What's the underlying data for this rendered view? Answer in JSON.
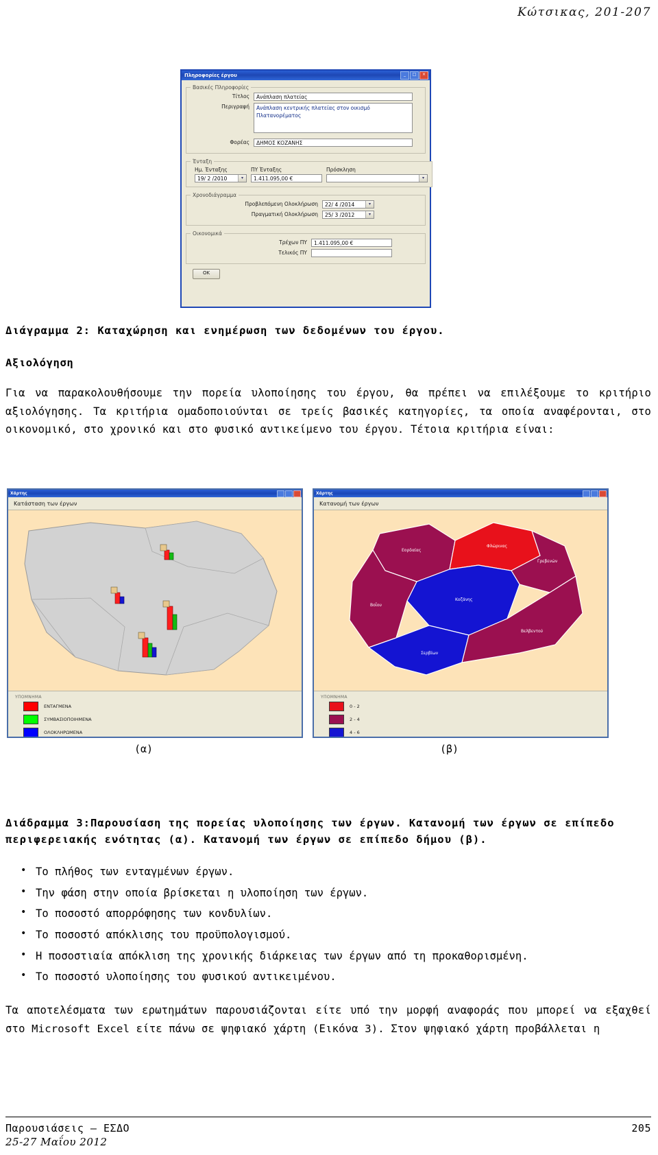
{
  "running_head": "Κώτσικας, 201-207",
  "dialog": {
    "title": "Πληροφορίες έργου",
    "window_buttons": [
      "minimize",
      "maximize",
      "close"
    ],
    "groups": {
      "basic": {
        "legend": "Βασικές Πληροφορίες",
        "fields": [
          {
            "label": "Τίτλος",
            "value": "Ανάπλαση πλατείας",
            "type": "text"
          },
          {
            "label": "Περιγραφή",
            "value": "Ανάπλαση κεντρικής πλατείας στον οικισμό Πλατανορέματος",
            "type": "textarea"
          },
          {
            "label": "Φορέας",
            "value": "ΔΗΜΟΣ ΚΟΖΑΝΗΣ",
            "type": "text"
          }
        ]
      },
      "entaxi": {
        "legend": "Ένταξη",
        "columns": [
          "Ημ. Ένταξης",
          "ΠΥ Ένταξης",
          "Πρόσκληση"
        ],
        "values": [
          "19/ 2 /2010",
          "1.411.095,00 €",
          ""
        ]
      },
      "schedule": {
        "legend": "Χρονοδιάγραμμα",
        "fields": [
          {
            "label": "Προβλεπόμενη Ολοκλήρωση",
            "value": "22/ 4 /2014"
          },
          {
            "label": "Πραγματική Ολοκλήρωση",
            "value": "25/ 3 /2012"
          }
        ]
      },
      "financial": {
        "legend": "Οικονομικά",
        "fields": [
          {
            "label": "Τρέχων ΠΥ",
            "value": "1.411.095,00 €"
          },
          {
            "label": "Τελικός ΠΥ",
            "value": ""
          }
        ]
      }
    },
    "ok_button": "OK"
  },
  "figure2_caption": "Διάγραμμα 2: Καταχώρηση και ενημέρωση των δεδομένων του έργου.",
  "section_heading": "Αξιολόγηση",
  "paragraph1": "Για να παρακολουθήσουμε την πορεία υλοποίησης του έργου, θα πρέπει να επιλέξουμε το κριτήριο αξιολόγησης. Τα κριτήρια ομαδοποιούνται σε τρείς βασικές κατηγορίες, τα οποία αναφέρονται, στο οικονομικό, στο χρονικό και στο φυσικό αντικείμενο του έργου. Τέτοια κριτήρια είναι:",
  "maps": {
    "left": {
      "window_title": "Χάρτης",
      "tab_label": "Κατάσταση των έργων",
      "legend_title": "ΥΠΟΜΝΗΜΑ",
      "legend_items": [
        {
          "label": "ΕΝΤΑΓΜΕΝΑ",
          "color": "#ff0000"
        },
        {
          "label": "ΣΥΜΒΑΣΙΟΠΟΙΗΜΕΝΑ",
          "color": "#00ff00"
        },
        {
          "label": "ΟΛΟΚΛΗΡΩΜΕΝΑ",
          "color": "#0000ff"
        }
      ],
      "sub_label": "(α)"
    },
    "right": {
      "window_title": "Χάρτης",
      "tab_label": "Κατανομή των έργων",
      "legend_title": "ΥΠΟΜΝΗΜΑ",
      "legend_items": [
        {
          "label": "0 - 2",
          "color": "#e8111b"
        },
        {
          "label": "2 - 4",
          "color": "#9b1050"
        },
        {
          "label": "4 - 6",
          "color": "#1414d2"
        }
      ],
      "sub_label": "(β)",
      "region_labels": [
        "Βόϊου",
        "Κοζάνης",
        "Σερβίων",
        "Εορδαίας",
        "Βελβεντού"
      ]
    }
  },
  "figure3_caption": "Διάδραμμα 3:Παρουσίαση της πορείας υλοποίησης των έργων. Κατανομή των έργων σε επίπεδο περιφερειακής ενότητας (α). Κατανομή των έργων σε επίπεδο δήμου (β).",
  "bullets": [
    "Το πλήθος των ενταγμένων έργων.",
    "Την φάση στην οποία βρίσκεται η υλοποίηση των έργων.",
    "Το ποσοστό απορρόφησης των κονδυλίων.",
    "Το ποσοστό απόκλισης του προϋπολογισμού.",
    "Η ποσοστιαία απόκλιση της χρονικής διάρκειας των έργων από τη προκαθορισμένη.",
    "Το ποσοστό υλοποίησης του φυσικού αντικειμένου."
  ],
  "paragraph2": "Τα αποτελέσματα των ερωτημάτων παρουσιάζονται είτε υπό την μορφή αναφοράς που μπορεί να εξαχθεί στο Microsoft Excel είτε πάνω σε ψηφιακό χάρτη (Εικόνα 3). Στον ψηφιακό χάρτη προβάλλεται η",
  "footer": {
    "left": "Παρουσιάσεις – ΕΣΔΟ",
    "right": "205",
    "date": "25-27 Μαΐου 2012"
  }
}
